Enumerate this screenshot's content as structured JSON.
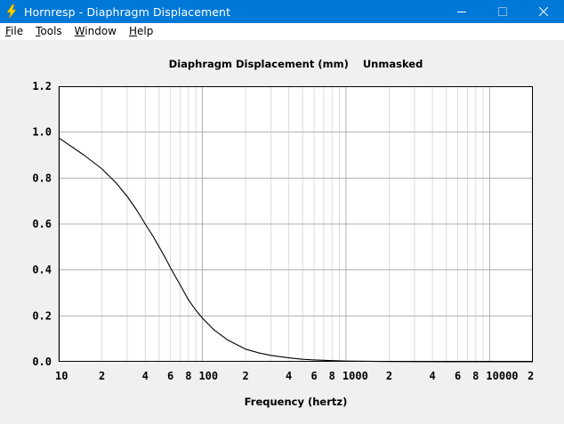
{
  "window": {
    "title": "Hornresp - Diaphragm Displacement"
  },
  "menu": {
    "items": [
      {
        "label": "File",
        "accel": "F",
        "rest": "ile"
      },
      {
        "label": "Tools",
        "accel": "T",
        "rest": "ools"
      },
      {
        "label": "Window",
        "accel": "W",
        "rest": "indow"
      },
      {
        "label": "Help",
        "accel": "H",
        "rest": "elp"
      }
    ]
  },
  "colors": {
    "titlebar": "#0078d7",
    "client": "#f0f0f0",
    "plot_bg": "#ffffff",
    "grid_major": "#b0b0b0",
    "grid_minor": "#dcdcdc",
    "curve": "#000000"
  },
  "chart_data": {
    "type": "line",
    "title": "Diaphragm Displacement (mm)    Unmasked",
    "xlabel": "Frequency (hertz)",
    "ylabel": "",
    "x_scale": "log",
    "xlim": [
      10,
      20000
    ],
    "ylim": [
      0,
      1.2
    ],
    "grid": true,
    "x_tick_labels": [
      {
        "value": 10,
        "label": "10"
      },
      {
        "value": 20,
        "label": "2"
      },
      {
        "value": 40,
        "label": "4"
      },
      {
        "value": 60,
        "label": "6"
      },
      {
        "value": 80,
        "label": "8"
      },
      {
        "value": 100,
        "label": "100"
      },
      {
        "value": 200,
        "label": "2"
      },
      {
        "value": 400,
        "label": "4"
      },
      {
        "value": 600,
        "label": "6"
      },
      {
        "value": 800,
        "label": "8"
      },
      {
        "value": 1000,
        "label": "1000"
      },
      {
        "value": 2000,
        "label": "2"
      },
      {
        "value": 4000,
        "label": "4"
      },
      {
        "value": 6000,
        "label": "6"
      },
      {
        "value": 8000,
        "label": "8"
      },
      {
        "value": 10000,
        "label": "10000"
      },
      {
        "value": 20000,
        "label": "2"
      }
    ],
    "y_tick_labels": [
      "0.0",
      "0.2",
      "0.4",
      "0.6",
      "0.8",
      "1.0",
      "1.2"
    ],
    "series": [
      {
        "x": [
          10,
          15,
          20,
          25,
          30,
          35,
          40,
          45,
          50,
          55,
          60,
          65,
          70,
          80,
          90,
          100,
          120,
          150,
          200,
          250,
          300,
          400,
          500,
          600,
          800,
          1000,
          2000,
          5000,
          10000,
          20000
        ],
        "y": [
          0.975,
          0.9,
          0.84,
          0.78,
          0.72,
          0.66,
          0.6,
          0.55,
          0.5,
          0.455,
          0.41,
          0.37,
          0.335,
          0.27,
          0.225,
          0.19,
          0.14,
          0.095,
          0.055,
          0.038,
          0.028,
          0.017,
          0.011,
          0.008,
          0.005,
          0.003,
          0.001,
          0.0003,
          0.0001,
          0.0
        ]
      }
    ]
  }
}
